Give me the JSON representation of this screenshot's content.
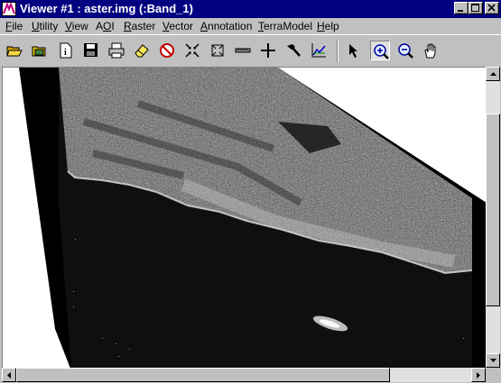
{
  "window": {
    "title": "Viewer #1 : aster.img (:Band_1)",
    "icons": {
      "app": "imagine-app-icon",
      "minimize": "minimize-icon",
      "maximize": "maximize-icon",
      "close": "close-icon"
    }
  },
  "menubar": {
    "items": [
      {
        "pre": "",
        "u": "F",
        "post": "ile"
      },
      {
        "pre": "",
        "u": "U",
        "post": "tility"
      },
      {
        "pre": "",
        "u": "V",
        "post": "iew"
      },
      {
        "pre": "A",
        "u": "O",
        "post": "I"
      },
      {
        "pre": "",
        "u": "R",
        "post": "aster"
      },
      {
        "pre": "",
        "u": "V",
        "post": "ector"
      },
      {
        "pre": "",
        "u": "A",
        "post": "nnotation"
      },
      {
        "pre": "",
        "u": "T",
        "post": "erraModel"
      },
      {
        "pre": "",
        "u": "H",
        "post": "elp"
      }
    ]
  },
  "toolbar": {
    "tools": [
      "open-folder-icon",
      "open-layer-icon",
      "info-icon",
      "save-icon",
      "print-icon",
      "eraser-icon",
      "no-draw-icon",
      "zoom-in-arrows-icon",
      "zoom-out-arrows-icon",
      "measure-icon",
      "crosshair-icon",
      "hammer-icon",
      "chart-icon",
      "select-arrow-icon",
      "zoom-in-icon",
      "zoom-out-icon",
      "pan-hand-icon"
    ],
    "active_tool": "zoom-in-icon"
  },
  "colors": {
    "titlebar": "#000080",
    "chrome": "#c0c0c0",
    "raster_background": "#ffffff",
    "nodata": "#000000"
  }
}
